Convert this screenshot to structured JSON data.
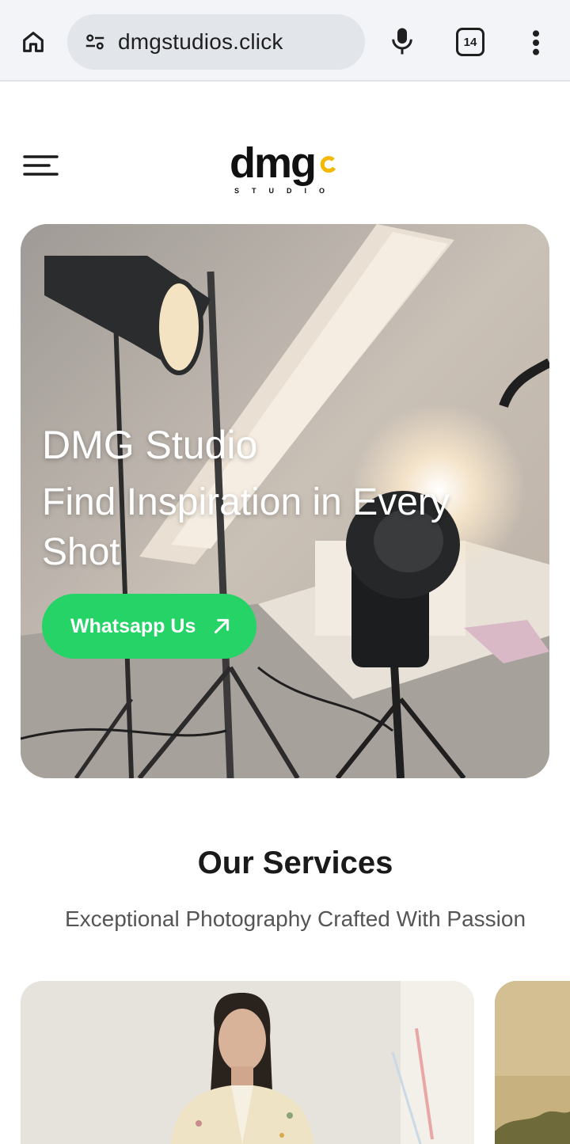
{
  "browser": {
    "url": "dmgstudios.click",
    "tab_count": "14"
  },
  "header": {
    "logo_main": "dmg",
    "logo_sub": "STUDIO"
  },
  "hero": {
    "title": "DMG Studio",
    "subtitle": "Find Inspiration in Every Shot",
    "cta_label": "Whatsapp Us"
  },
  "services": {
    "title": "Our Services",
    "subtitle": "Exceptional Photography Crafted With Passion"
  },
  "colors": {
    "accent_green": "#25d366",
    "logo_yellow": "#f5b800",
    "chrome_bg": "#f2f4f8"
  }
}
